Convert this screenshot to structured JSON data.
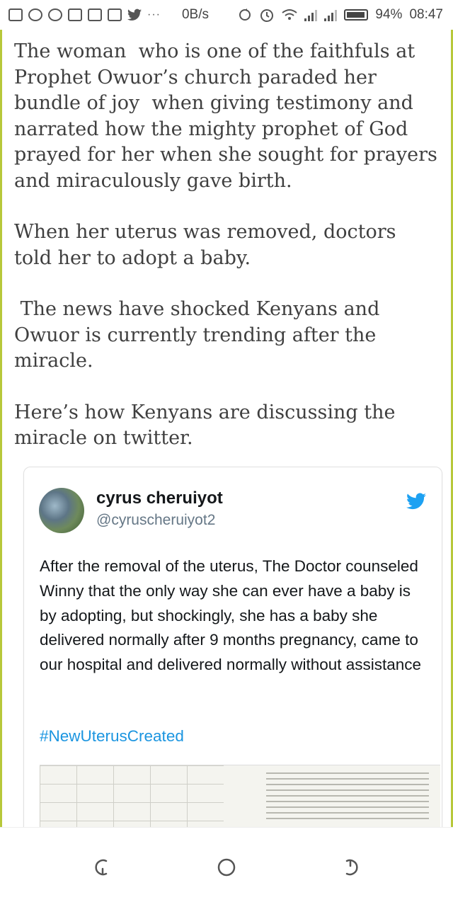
{
  "status_bar": {
    "network_speed": "0B/s",
    "battery_percent": "94%",
    "time": "08:47",
    "overflow": "···"
  },
  "article": {
    "paragraphs": [
      "The woman  who is one of the faithfuls at Prophet Owuor’s church paraded her bundle of joy  when giving testimony and narrated how the mighty prophet of God prayed for her when she sought for prayers and miraculously gave birth.",
      "When her uterus was removed, doctors told her to adopt a baby.",
      " The news have shocked Kenyans and Owuor is currently trending after the miracle.",
      "Here’s how Kenyans are discussing the miracle on twitter."
    ]
  },
  "tweet": {
    "name": "cyrus cheruiyot",
    "handle": "@cyruscheruiyot2",
    "text": "After the removal of the uterus, The Doctor counseled Winny that the only way she can ever have a baby is by adopting, but shockingly, she has a baby she delivered normally after 9 months pregnancy, came to our hospital and delivered normally without assistance",
    "hashtag": "#NewUterusCreated",
    "accent_color": "#1b95e0",
    "icon": "twitter-bird-icon"
  },
  "nav_bar": {
    "icons": [
      "back-icon",
      "home-icon",
      "recents-icon"
    ]
  }
}
